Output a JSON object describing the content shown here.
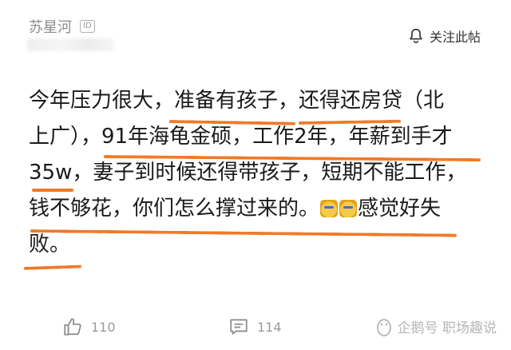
{
  "author": {
    "name": "苏星河",
    "badge": "ID"
  },
  "follow": {
    "label": "关注此帖",
    "icon": "bell-icon"
  },
  "post": {
    "lines": [
      "今年压力很大，准备有孩子，还得还房贷（北",
      "上广），91年海龟金硕，工作2年，年薪到手才",
      "35w，妻子到时候还得带孩子，短期不能工作，",
      "钱不够花，你们怎么撑过来的。",
      "败。"
    ],
    "line4_tail": "感觉好失",
    "emoji_names": [
      "crying-face-icon",
      "crying-face-icon"
    ],
    "highlight_color": "#f07a28"
  },
  "actions": {
    "like": {
      "icon": "thumbs-up-icon",
      "count": "110"
    },
    "comment": {
      "icon": "comment-icon",
      "count": "114"
    }
  },
  "watermark": {
    "text": "企鹅号 职场趣说",
    "icon": "penguin-logo-icon"
  }
}
